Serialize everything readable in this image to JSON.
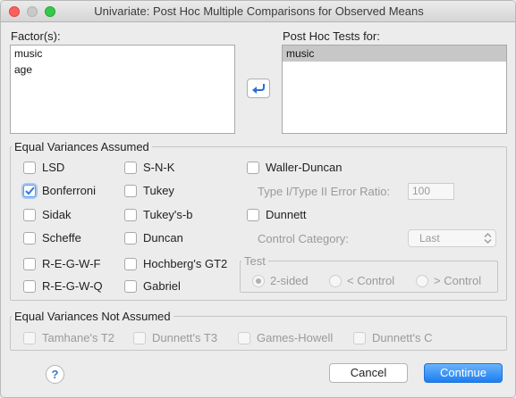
{
  "window": {
    "title": "Univariate: Post Hoc Multiple Comparisons for Observed Means"
  },
  "factors": {
    "label": "Factor(s):",
    "items": [
      "music",
      "age"
    ]
  },
  "posthoc_for": {
    "label": "Post Hoc Tests for:",
    "items": [
      "music"
    ]
  },
  "equal_variances": {
    "legend": "Equal Variances Assumed",
    "col1": [
      {
        "label": "LSD",
        "checked": false
      },
      {
        "label": "Bonferroni",
        "checked": true
      },
      {
        "label": "Sidak",
        "checked": false
      },
      {
        "label": "Scheffe",
        "checked": false
      },
      {
        "label": "R-E-G-W-F",
        "checked": false
      },
      {
        "label": "R-E-G-W-Q",
        "checked": false
      }
    ],
    "col2": [
      {
        "label": "S-N-K",
        "checked": false
      },
      {
        "label": "Tukey",
        "checked": false
      },
      {
        "label": "Tukey's-b",
        "checked": false
      },
      {
        "label": "Duncan",
        "checked": false
      },
      {
        "label": "Hochberg's GT2",
        "checked": false
      },
      {
        "label": "Gabriel",
        "checked": false
      }
    ],
    "waller_duncan": "Waller-Duncan",
    "error_ratio_label": "Type I/Type II Error Ratio:",
    "error_ratio_value": "100",
    "dunnett": "Dunnett",
    "control_category_label": "Control Category:",
    "control_category_value": "Last",
    "test_legend": "Test",
    "test_options": [
      "2-sided",
      "< Control",
      "> Control"
    ]
  },
  "not_assumed": {
    "legend": "Equal Variances Not Assumed",
    "options": [
      "Tamhane's T2",
      "Dunnett's T3",
      "Games-Howell",
      "Dunnett's C"
    ]
  },
  "buttons": {
    "help": "?",
    "cancel": "Cancel",
    "continue": "Continue"
  },
  "colors": {
    "accent": "#1d7ef1",
    "check": "#2f7ad8"
  }
}
